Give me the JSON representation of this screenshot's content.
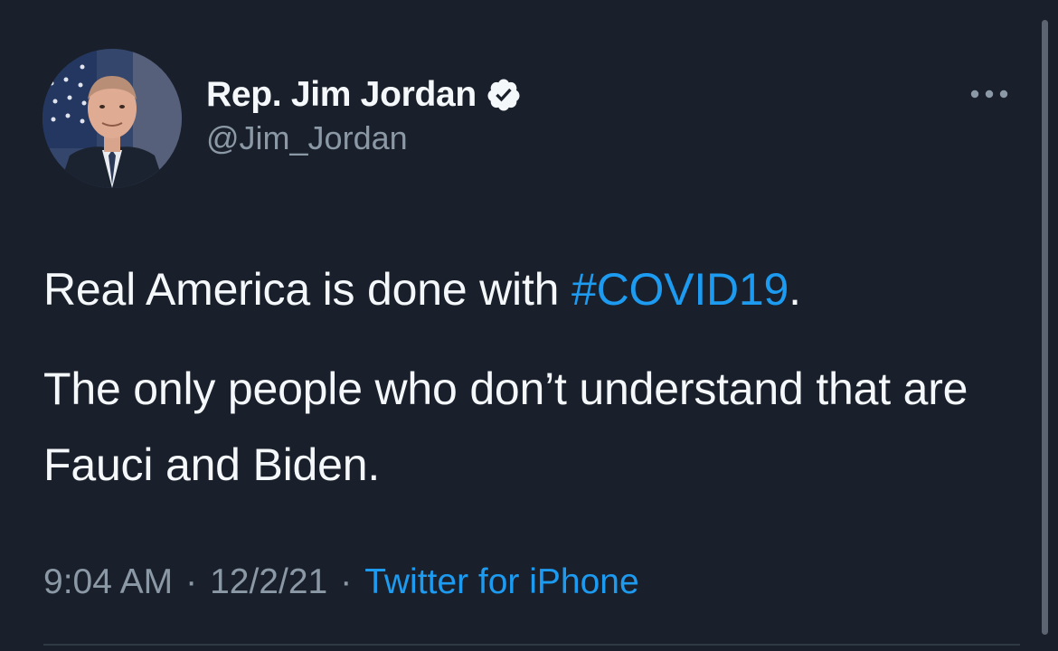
{
  "author": {
    "display_name": "Rep. Jim Jordan",
    "handle": "@Jim_Jordan",
    "verified_icon": "verified-badge-icon",
    "avatar_icon": "profile-photo"
  },
  "menu": {
    "more_icon": "more-options-icon"
  },
  "tweet": {
    "line1_text": "Real America is done with ",
    "hashtag": "#COVID19",
    "line1_end": ".",
    "line2_text": "The only people who don’t understand that are Fauci and Biden."
  },
  "meta": {
    "time": "9:04 AM",
    "separator": "·",
    "date": "12/2/21",
    "source": "Twitter for iPhone"
  },
  "colors": {
    "background": "#1a202b",
    "text": "#f5f8fa",
    "secondary": "#8b98a5",
    "link": "#1d9bf0"
  }
}
